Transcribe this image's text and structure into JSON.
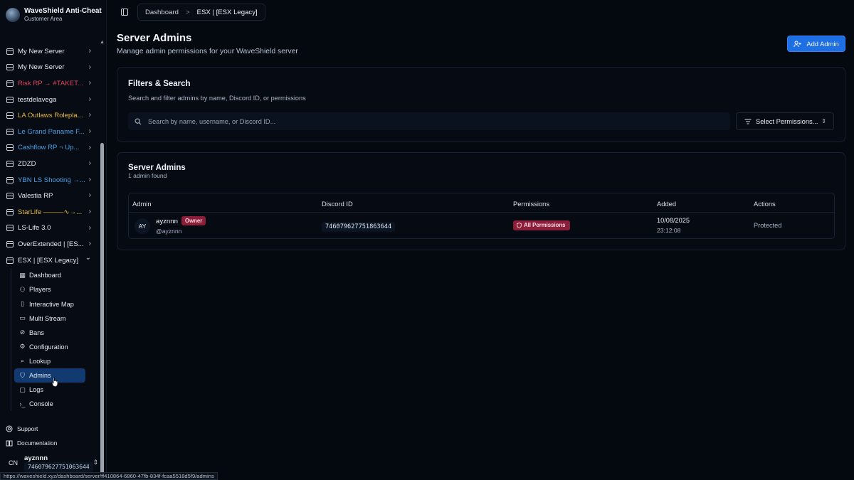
{
  "brand": {
    "title": "WaveShield Anti-Cheat",
    "subtitle": "Customer Area"
  },
  "servers": [
    {
      "label": "My New Server",
      "color": "#e4eaf2"
    },
    {
      "label": "My New Server",
      "color": "#e4eaf2"
    },
    {
      "label": "Risk RP → #TAKET...",
      "color": "#e0455a"
    },
    {
      "label": "testdelavega",
      "color": "#e4eaf2"
    },
    {
      "label": "LA Outlaws Rolepla...",
      "color": "#e6b93a"
    },
    {
      "label": "Le Grand Paname F...",
      "color": "#4aa3e8"
    },
    {
      "label": "Cashflow RP ¬ Up...",
      "color": "#4aa3e8"
    },
    {
      "label": "ZDZD",
      "color": "#e4eaf2"
    },
    {
      "label": "YBN LS Shooting →...",
      "color": "#4aa3e8"
    },
    {
      "label": "Valestia RP",
      "color": "#e4eaf2"
    },
    {
      "label": "StarLife ———∿→...",
      "color": "#e6b93a"
    },
    {
      "label": "LS-Life 3.0",
      "color": "#e4eaf2"
    },
    {
      "label": "OverExtended | [ES...",
      "color": "#e4eaf2"
    },
    {
      "label": "ESX | [ESX Legacy]",
      "color": "#e4eaf2"
    }
  ],
  "subnav": [
    {
      "label": "Dashboard",
      "icon": "grid-icon"
    },
    {
      "label": "Players",
      "icon": "users-icon"
    },
    {
      "label": "Interactive Map",
      "icon": "map-icon"
    },
    {
      "label": "Multi Stream",
      "icon": "monitor-icon"
    },
    {
      "label": "Bans",
      "icon": "ban-icon"
    },
    {
      "label": "Configuration",
      "icon": "gear-icon"
    },
    {
      "label": "Lookup",
      "icon": "search-icon"
    },
    {
      "label": "Admins",
      "icon": "shield-icon",
      "active": true
    },
    {
      "label": "Logs",
      "icon": "file-icon"
    },
    {
      "label": "Console",
      "icon": "terminal-icon"
    }
  ],
  "bottom_links": {
    "support": "Support",
    "documentation": "Documentation"
  },
  "user": {
    "initials": "CN",
    "name": "ayznnn",
    "discord_id": "746079627751063644"
  },
  "status_url": "https://waveshield.xyz/dashboard/server/ff410864-6860-47fb-834f-fcaa5518d5f9/admins",
  "breadcrumb": {
    "root": "Dashboard",
    "sep": ">",
    "current": "ESX | [ESX Legacy]"
  },
  "page": {
    "title": "Server Admins",
    "subtitle": "Manage admin permissions for your WaveShield server",
    "add_label": "Add Admin"
  },
  "filters": {
    "title": "Filters & Search",
    "subtitle": "Search and filter admins by name, Discord ID, or permissions",
    "search_placeholder": "Search by name, username, or Discord ID...",
    "perm_select": "Select Permissions..."
  },
  "admins_card": {
    "title": "Server Admins",
    "count_text": "1 admin found",
    "columns": [
      "Admin",
      "Discord ID",
      "Permissions",
      "Added",
      "Actions"
    ],
    "rows": [
      {
        "initials": "AY",
        "name": "ayznnn",
        "role": "Owner",
        "handle": "@ayznnn",
        "discord_id": "746079627751863644",
        "permissions": "All Permissions",
        "date": "10/08/2025",
        "time": "23:12:08",
        "action": "Protected"
      }
    ]
  }
}
